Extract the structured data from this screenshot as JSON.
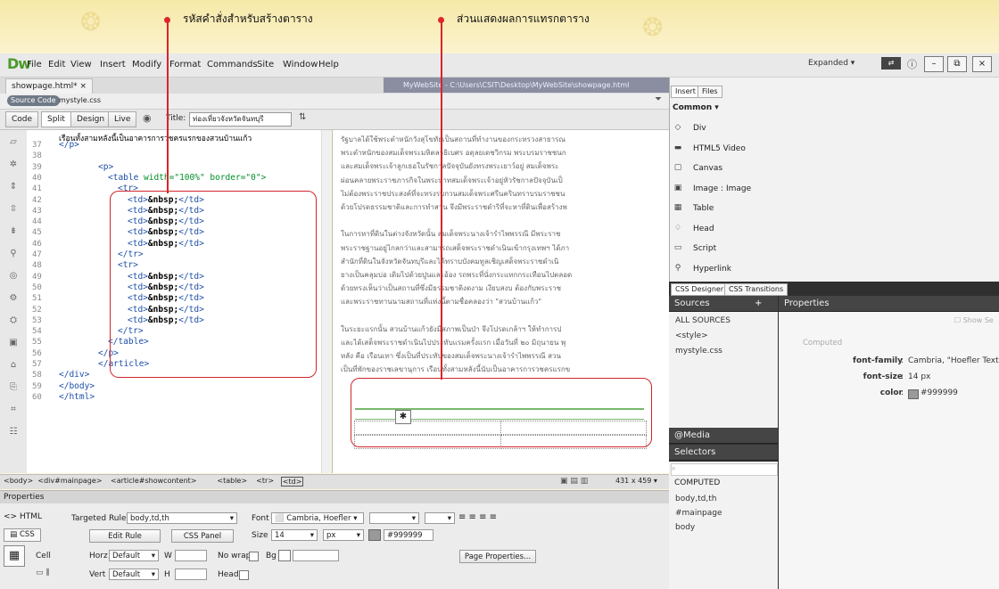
{
  "annotations": {
    "code_label": "รหัสคำสั่งสำหรับสร้างตาราง",
    "view_label": "ส่วนแสดงผลการแทรกตาราง"
  },
  "app": {
    "logo": "Dw",
    "menu": [
      "File",
      "Edit",
      "View",
      "Insert",
      "Modify",
      "Format",
      "Commands",
      "Site",
      "Window",
      "Help"
    ],
    "workspace": "Expanded",
    "window_buttons": [
      "–",
      "⧉",
      "×"
    ]
  },
  "document": {
    "tab": "showpage.html*",
    "close": "×",
    "path": "MyWebSite - C:\\Users\\CSIT\\Desktop\\MyWebSite\\showpage.html",
    "source_code": "Source Code",
    "related_file": "mystyle.css",
    "views": [
      "Code",
      "Split",
      "Design",
      "Live"
    ],
    "title_label": "Title:",
    "title_value": "ท่องเที่ยวจังหวัดจันทบุรี"
  },
  "code": {
    "line_numbers": [
      "37",
      "38",
      "39",
      "40",
      "41",
      "42",
      "43",
      "44",
      "45",
      "46",
      "47",
      "48",
      "49",
      "50",
      "51",
      "52",
      "53",
      "54",
      "55",
      "56",
      "57",
      "58",
      "59",
      "60"
    ],
    "first_line_text": "เรือนทั้งสามหลังนี้เป็นอาคารการวชครแรกของสวนบ้านแก้ว",
    "lines": [
      {
        "indent": 0,
        "tag": "</p>"
      },
      {
        "indent": 0,
        "tag": ""
      },
      {
        "indent": 4,
        "tag": "<p>"
      },
      {
        "indent": 5,
        "tag": "<table",
        "attrs": " width=\"100%\" border=\"0\">"
      },
      {
        "indent": 6,
        "tag": "<tr>"
      },
      {
        "indent": 7,
        "tag": "<td>",
        "text": "&nbsp;",
        "close": "</td>"
      },
      {
        "indent": 7,
        "tag": "<td>",
        "text": "&nbsp;",
        "close": "</td>"
      },
      {
        "indent": 7,
        "tag": "<td>",
        "text": "&nbsp;",
        "close": "</td>"
      },
      {
        "indent": 7,
        "tag": "<td>",
        "text": "&nbsp;",
        "close": "</td>"
      },
      {
        "indent": 7,
        "tag": "<td>",
        "text": "&nbsp;",
        "close": "</td>"
      },
      {
        "indent": 6,
        "tag": "</tr>"
      },
      {
        "indent": 6,
        "tag": "<tr>"
      },
      {
        "indent": 7,
        "tag": "<td>",
        "text": "&nbsp;",
        "close": "</td>"
      },
      {
        "indent": 7,
        "tag": "<td>",
        "text": "&nbsp;",
        "close": "</td>"
      },
      {
        "indent": 7,
        "tag": "<td>",
        "text": "&nbsp;",
        "close": "</td>"
      },
      {
        "indent": 7,
        "tag": "<td>",
        "text": "&nbsp;",
        "close": "</td>"
      },
      {
        "indent": 7,
        "tag": "<td>",
        "text": "&nbsp;",
        "close": "</td>"
      },
      {
        "indent": 6,
        "tag": "</tr>"
      },
      {
        "indent": 5,
        "tag": "</table>"
      },
      {
        "indent": 4,
        "tag": "</p>"
      },
      {
        "indent": 4,
        "tag": "</article>"
      },
      {
        "indent": 0,
        "tag": "</div>"
      },
      {
        "indent": 0,
        "tag": "</body>"
      },
      {
        "indent": 0,
        "tag": "</html>"
      }
    ]
  },
  "design": {
    "paragraphs": [
      "รัฐบาลได้ใช้พระตำหนักวังสุโขทัยเป็นสถานที่ทำงานของกระทรวงสาธารณ",
      "พระตำหนักของสมเด็จพระมหิตลาธิเบศร อดุลยเดชวิกรม พระบรมราชชนก",
      "และสมเด็จพระเจ้าลูกเธอในรัชกาลปัจจุบันยังทรงพระเยาว์อยู่ สมเด็จพระ",
      "ผ่อนคลายพระราชภารกิจในพระบาทสมเด็จพระเจ้าอยู่หัวรัชกาลปัจจุบันเป็",
      "ไม่ต้องพระราชประสงค์ที่จะทรงรบกวนสมเด็จพระศรีนครินทราบรมราชชน",
      "ด้วยโปรดธรรมชาติและการทำสวน จึงมีพระราชดำริที่จะหาที่ดินเพื่อสร้างพ",
      "",
      "ในการหาที่ดินในต่างจังหวัดนั้น สมเด็จพระนางเจ้ารำไพพรรณี มีพระราช",
      "พระราชฐานอยู่ไกลกว่าและสามารถเสด็จพระราชดำเนินเข้ากรุงเทพฯ ได้ภา",
      "สำนักที่ดินในจังหวัดจันทบุรีและได้ทราบบังคมทูลเชิญเสด็จพระราชดำเนิ",
      "ยางเป็นคลุมบ่อ เดิมไปด้วยปูนและอ้อง รถพระที่นั่งกระแทกกระเทือนไปตลอด",
      "ด้วยทรงเห็นว่าเป็นสถานที่ซึ่งมีธรรมชาติงดงาม เงียบสงบ ต้องกับพระราช",
      "และพระราชทานนามสถานที่แห่งนี้ตามชื่อคลองว่า \"สวนบ้านแก้ว\"",
      "",
      "ในระยะแรกนั้น สวนบ้านแก้วยังมีสภาพเป็นป่า จึงโปรดเกล้าฯ ให้ทำการป",
      "และได้เสด็จพระราชดำเนินไปประทับแรมครั้งแรก เมื่อวันที่ ๒๐ มิถุนายน พุ",
      "หลัง คือ เรือนเทา ซึ่งเป็นที่ประทับของสมเด็จพระนางเจ้ารำไพพรรณี สวน",
      "เป็นที่พักของราชเลขานุการ เรือนทั้งสามหลังนี้นับเป็นอาคารการวชครแรกข"
    ],
    "dimensions": "431 x 459"
  },
  "status": {
    "tag_path": [
      "<body>",
      "<div#mainpage>",
      "<article#showcontent>",
      "<table>",
      "<tr>",
      "<td>"
    ]
  },
  "properties": {
    "title": "Properties",
    "html_btn": "HTML",
    "css_btn": "CSS",
    "targeted_rule_label": "Targeted Rule",
    "targeted_rule": "body,td,th",
    "edit_rule": "Edit Rule",
    "css_panel": "CSS Panel",
    "font_label": "Font",
    "font_value": "Cambria, Hoefler",
    "size_label": "Size",
    "size_value": "14",
    "size_unit": "px",
    "color_value": "#999999",
    "cell_label": "Cell",
    "horz_label": "Horz",
    "horz_value": "Default",
    "vert_label": "Vert",
    "vert_value": "Default",
    "w_label": "W",
    "h_label": "H",
    "nowrap_label": "No wrap",
    "bg_label": "Bg",
    "header_label": "Header",
    "page_properties": "Page Properties..."
  },
  "insert_panel": {
    "tabs": [
      "Insert",
      "Files"
    ],
    "category": "Common",
    "items": [
      "Div",
      "HTML5 Video",
      "Canvas",
      "Image : Image",
      "Table",
      "Head",
      "Script",
      "Hyperlink"
    ]
  },
  "css_designer": {
    "tabs": [
      "CSS Designer",
      "CSS Transitions"
    ],
    "sources_label": "Sources",
    "properties_label": "Properties",
    "show_set": "Show Se",
    "sources": [
      "ALL SOURCES",
      "<style>",
      "mystyle.css"
    ],
    "computed_header": "Computed",
    "computed_props": [
      {
        "name": "font-family",
        "value": "Cambria, \"Hoefler Text\"..."
      },
      {
        "name": "font-size",
        "value": "14 px"
      },
      {
        "name": "color",
        "value": "#999999"
      }
    ],
    "media_label": "@Media",
    "selectors_label": "Selectors",
    "computed_label": "COMPUTED",
    "selectors": [
      "body,td,th",
      "#mainpage",
      "body"
    ]
  },
  "colors": {
    "accent": "#4c9a2a",
    "annotation": "#d9252b",
    "swatch": "#999999"
  }
}
